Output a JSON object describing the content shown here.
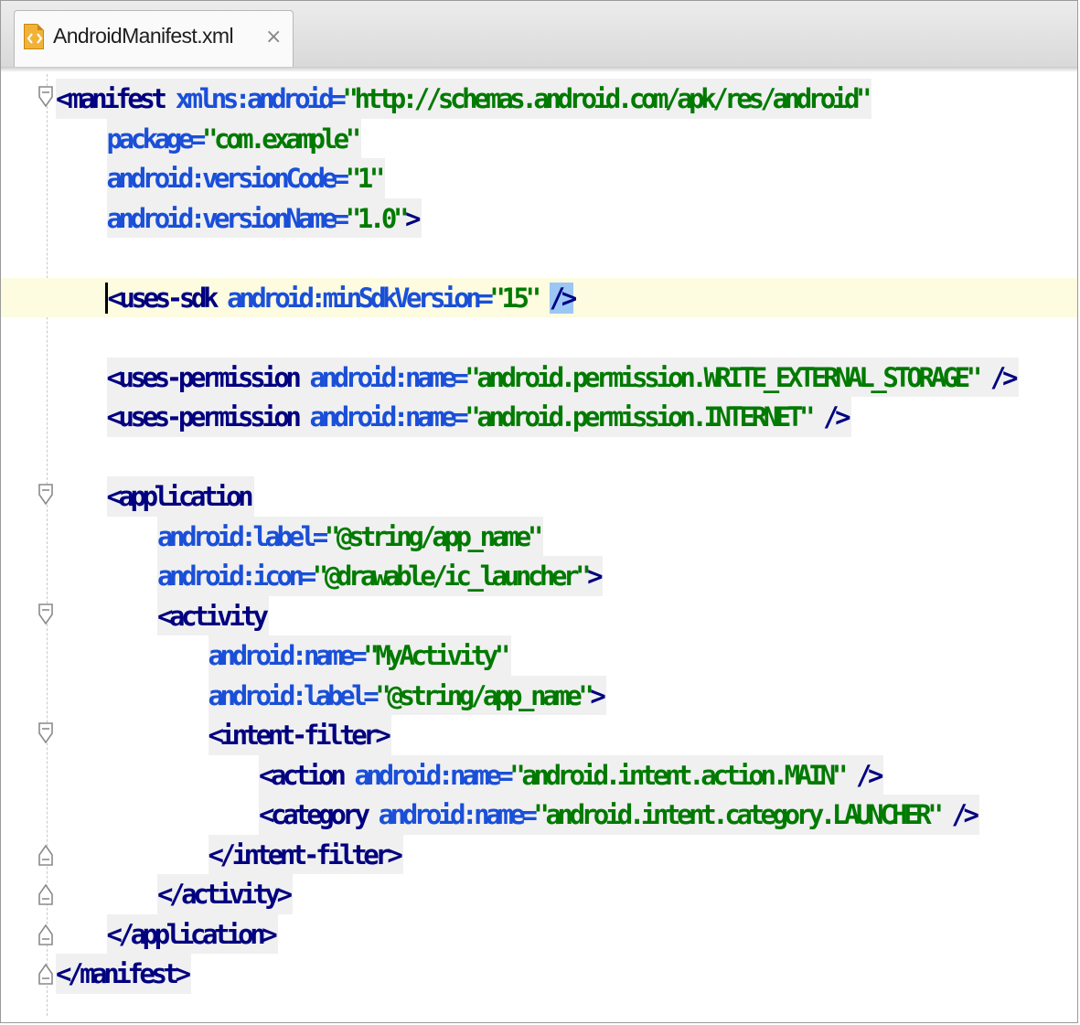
{
  "tab": {
    "title": "AndroidManifest.xml",
    "close_symbol": "×",
    "icon": "xml-file-icon"
  },
  "lines": [
    {
      "indent": 0,
      "fold": "open",
      "tokens": [
        {
          "t": "tag",
          "v": "<manifest "
        },
        {
          "t": "attr",
          "v": "xmlns:android="
        },
        {
          "t": "val",
          "v": "\"http://schemas.android.com/apk/res/android\""
        }
      ]
    },
    {
      "indent": 1,
      "tokens": [
        {
          "t": "attr",
          "v": "package="
        },
        {
          "t": "val",
          "v": "\"com.example\""
        }
      ]
    },
    {
      "indent": 1,
      "tokens": [
        {
          "t": "attr",
          "v": "android:versionCode="
        },
        {
          "t": "val",
          "v": "\"1\""
        }
      ]
    },
    {
      "indent": 1,
      "tokens": [
        {
          "t": "attr",
          "v": "android:versionName="
        },
        {
          "t": "val",
          "v": "\"1.0\""
        },
        {
          "t": "punc",
          "v": ">"
        }
      ]
    },
    {
      "indent": 0,
      "tokens": []
    },
    {
      "indent": 1,
      "current": true,
      "tokens": [
        {
          "t": "tag",
          "v": "<uses-sdk "
        },
        {
          "t": "attr",
          "v": "android:minSdkVersion="
        },
        {
          "t": "val",
          "v": "\"15\" "
        },
        {
          "t": "punc",
          "v": "/>"
        }
      ]
    },
    {
      "indent": 0,
      "tokens": []
    },
    {
      "indent": 1,
      "tokens": [
        {
          "t": "tag",
          "v": "<uses-permission "
        },
        {
          "t": "attr",
          "v": "android:name="
        },
        {
          "t": "val",
          "v": "\"android.permission.WRITE_EXTERNAL_STORAGE\" "
        },
        {
          "t": "punc",
          "v": "/>"
        }
      ]
    },
    {
      "indent": 1,
      "tokens": [
        {
          "t": "tag",
          "v": "<uses-permission "
        },
        {
          "t": "attr",
          "v": "android:name="
        },
        {
          "t": "val",
          "v": "\"android.permission.INTERNET\" "
        },
        {
          "t": "punc",
          "v": "/>"
        }
      ]
    },
    {
      "indent": 0,
      "tokens": []
    },
    {
      "indent": 1,
      "fold": "open",
      "tokens": [
        {
          "t": "tag",
          "v": "<application"
        }
      ]
    },
    {
      "indent": 2,
      "tokens": [
        {
          "t": "attr",
          "v": "android:label="
        },
        {
          "t": "val",
          "v": "\"@string/app_name\""
        }
      ]
    },
    {
      "indent": 2,
      "tokens": [
        {
          "t": "attr",
          "v": "android:icon="
        },
        {
          "t": "val",
          "v": "\"@drawable/ic_launcher\""
        },
        {
          "t": "punc",
          "v": ">"
        }
      ]
    },
    {
      "indent": 2,
      "fold": "open",
      "tokens": [
        {
          "t": "tag",
          "v": "<activity"
        }
      ]
    },
    {
      "indent": 3,
      "tokens": [
        {
          "t": "attr",
          "v": "android:name="
        },
        {
          "t": "val",
          "v": "\"MyActivity\""
        }
      ]
    },
    {
      "indent": 3,
      "tokens": [
        {
          "t": "attr",
          "v": "android:label="
        },
        {
          "t": "val",
          "v": "\"@string/app_name\""
        },
        {
          "t": "punc",
          "v": ">"
        }
      ]
    },
    {
      "indent": 3,
      "fold": "open",
      "tokens": [
        {
          "t": "tag",
          "v": "<intent-filter>"
        }
      ]
    },
    {
      "indent": 4,
      "tokens": [
        {
          "t": "tag",
          "v": "<action "
        },
        {
          "t": "attr",
          "v": "android:name="
        },
        {
          "t": "val",
          "v": "\"android.intent.action.MAIN\" "
        },
        {
          "t": "punc",
          "v": "/>"
        }
      ]
    },
    {
      "indent": 4,
      "tokens": [
        {
          "t": "tag",
          "v": "<category "
        },
        {
          "t": "attr",
          "v": "android:name="
        },
        {
          "t": "val",
          "v": "\"android.intent.category.LAUNCHER\" "
        },
        {
          "t": "punc",
          "v": "/>"
        }
      ]
    },
    {
      "indent": 3,
      "fold": "close",
      "tokens": [
        {
          "t": "tag",
          "v": "</intent-filter>"
        }
      ]
    },
    {
      "indent": 2,
      "fold": "close",
      "tokens": [
        {
          "t": "tag",
          "v": "</activity>"
        }
      ]
    },
    {
      "indent": 1,
      "fold": "close",
      "tokens": [
        {
          "t": "tag",
          "v": "</application>"
        }
      ]
    },
    {
      "indent": 0,
      "fold": "close",
      "tokens": [
        {
          "t": "tag",
          "v": "</manifest>"
        }
      ]
    }
  ]
}
